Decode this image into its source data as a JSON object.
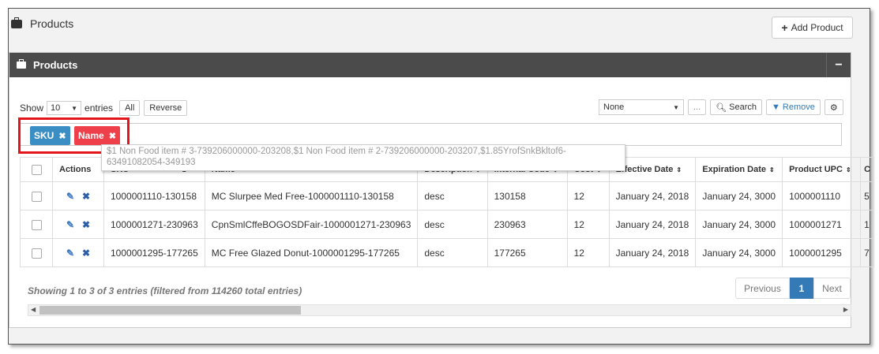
{
  "page": {
    "title": "Products",
    "add_button": "Add Product"
  },
  "panel": {
    "title": "Products",
    "collapse": "−"
  },
  "controls": {
    "show_label": "Show",
    "page_size": "10",
    "entries_label": "entries",
    "all_btn": "All",
    "reverse_btn": "Reverse",
    "column_select": "None",
    "ellipsis_btn": "...",
    "search_btn": "Search",
    "remove_btn": "Remove"
  },
  "tags": [
    {
      "label": "SKU",
      "color": "#3a8ec4"
    },
    {
      "label": "Name",
      "color": "#ee3f4a"
    }
  ],
  "tooltip": "$1 Non Food item # 3-739206000000-203208,$1 Non Food item # 2-739206000000-203207,$1.85YrofSnkBkltof6-63491082054-349193",
  "table": {
    "columns": [
      "Actions",
      "SKU",
      "Name",
      "Description",
      "Internal Code",
      "Cost",
      "Effective Date",
      "Expiration Date",
      "Product UPC",
      "C"
    ],
    "rows": [
      [
        "1000001110-130158",
        "MC Slurpee Med Free-1000001110-130158",
        "desc",
        "130158",
        "12",
        "January 24, 2018",
        "January 24, 3000",
        "1000001110",
        "5"
      ],
      [
        "1000001271-230963",
        "CpnSmlCffeBOGOSDFair-1000001271-230963",
        "desc",
        "230963",
        "12",
        "January 24, 2018",
        "January 24, 3000",
        "1000001271",
        "1"
      ],
      [
        "1000001295-177265",
        "MC Free Glazed Donut-1000001295-177265",
        "desc",
        "177265",
        "12",
        "January 24, 2018",
        "January 24, 3000",
        "1000001295",
        "7"
      ]
    ]
  },
  "footer": {
    "info": "Showing 1 to 3 of 3 entries (filtered from 114260 total entries)",
    "previous": "Previous",
    "current_page": "1",
    "next": "Next"
  },
  "colors": {
    "header_bar": "#4b4b4b",
    "accent_blue": "#337ab7",
    "tag_sku": "#3a8ec4",
    "tag_name": "#ee3f4a",
    "highlight": "#e3151b"
  }
}
